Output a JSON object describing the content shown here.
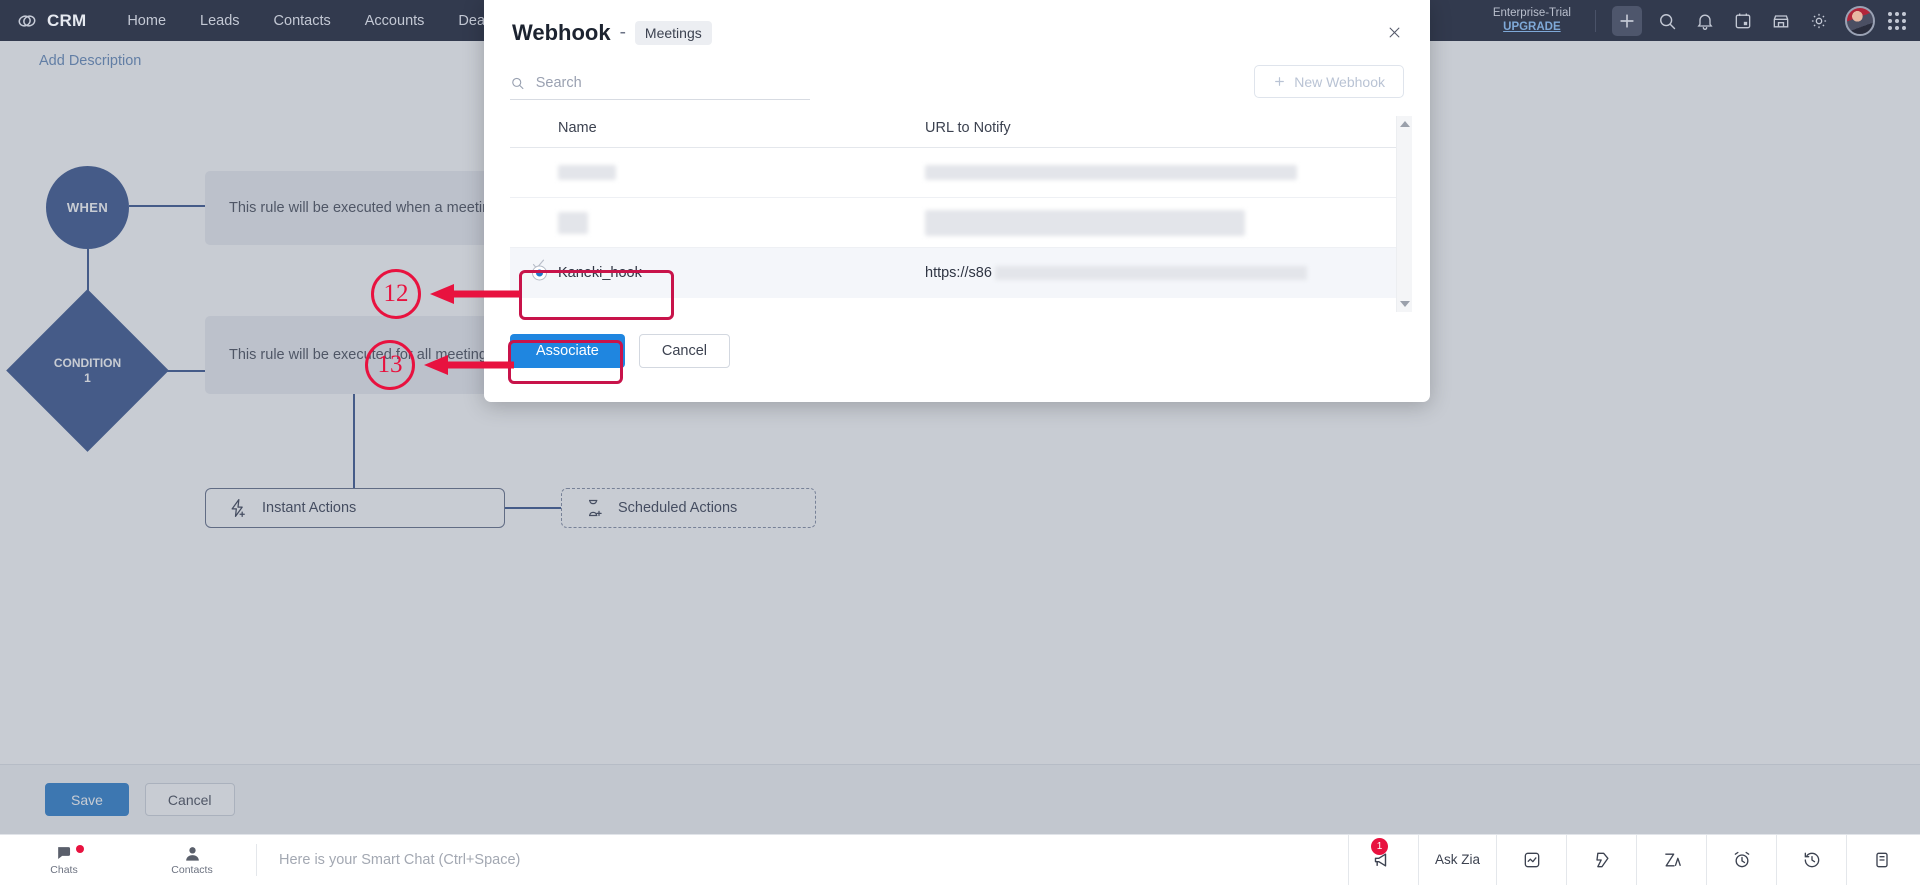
{
  "appbar": {
    "brand": "CRM",
    "tabs": [
      "Home",
      "Leads",
      "Contacts",
      "Accounts",
      "Deals"
    ],
    "trial_label": "Enterprise-Trial",
    "trial_upgrade": "UPGRADE",
    "icons": [
      "plus-icon",
      "search-icon",
      "bell-icon",
      "calendar-icon",
      "store-icon",
      "gear-icon",
      "avatar",
      "app-grid-icon"
    ]
  },
  "page": {
    "add_description": "Add Description",
    "when_label": "WHEN",
    "condition_label_line1": "CONDITION",
    "condition_label_line2": "1",
    "rule_when_text": "This rule will be executed when a meeting",
    "rule_condition_text": "This rule will be executed for all meeting",
    "instant_actions": "Instant Actions",
    "scheduled_actions": "Scheduled Actions",
    "save_label": "Save",
    "cancel_label": "Cancel"
  },
  "modal": {
    "title": "Webhook",
    "separator": "-",
    "module_chip": "Meetings",
    "close_icon": "close-icon",
    "search_placeholder": "Search",
    "search_value": "",
    "new_webhook_label": "New Webhook",
    "columns": [
      "Name",
      "URL to Notify"
    ],
    "rows": [
      {
        "name": "",
        "url": "",
        "redacted": true,
        "selected": false
      },
      {
        "name": "",
        "url": "",
        "redacted": true,
        "selected": false
      },
      {
        "name": "Kaneki_hook",
        "url": "https://s86",
        "redacted": false,
        "selected": true
      }
    ],
    "associate_label": "Associate",
    "cancel_label": "Cancel"
  },
  "annotations": [
    {
      "number": "12",
      "target": "selected webhook row Kaneki_hook"
    },
    {
      "number": "13",
      "target": "Associate button"
    }
  ],
  "taskbar": {
    "left_items": [
      {
        "label": "Chats",
        "icon": "chat-icon",
        "badge": true
      },
      {
        "label": "Contacts",
        "icon": "person-icon",
        "badge": false
      }
    ],
    "smart_chat_placeholder": "Here is your Smart Chat (Ctrl+Space)",
    "right_items": [
      {
        "label": "",
        "icon": "megaphone-icon",
        "badge": "1"
      },
      {
        "label": "Ask Zia",
        "icon": "",
        "badge": ""
      },
      {
        "label": "",
        "icon": "analytics-icon",
        "badge": ""
      },
      {
        "label": "",
        "icon": "signals-icon",
        "badge": ""
      },
      {
        "label": "",
        "icon": "zia-icon",
        "badge": ""
      },
      {
        "label": "",
        "icon": "alarm-icon",
        "badge": ""
      },
      {
        "label": "",
        "icon": "history-icon",
        "badge": ""
      },
      {
        "label": "",
        "icon": "notes-icon",
        "badge": ""
      }
    ]
  },
  "colors": {
    "appbar_bg": "#323a4e",
    "node_blue": "#2c4a87",
    "primary_blue": "#1f86e0",
    "save_blue": "#1f76c9",
    "annotation_red": "#e8123f"
  }
}
